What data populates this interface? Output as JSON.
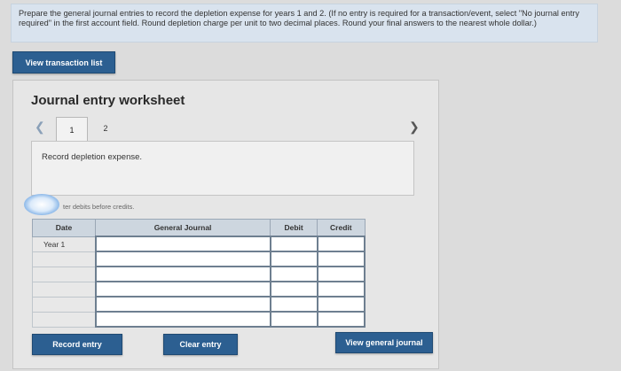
{
  "instructions": "Prepare the general journal entries to record the depletion expense for years 1 and 2. (If no entry is required for a transaction/event, select \"No journal entry required\" in the first account field. Round depletion charge per unit to two decimal places. Round your final answers to the nearest whole dollar.)",
  "buttons": {
    "view_transaction_list": "View transaction list",
    "record_entry": "Record entry",
    "clear_entry": "Clear entry",
    "view_general_journal": "View general journal"
  },
  "worksheet": {
    "title": "Journal entry worksheet",
    "prev_icon": "chevron-left",
    "next_icon": "chevron-right",
    "tabs": [
      "1",
      "2"
    ],
    "active_tab": "1",
    "prompt": "Record depletion expense.",
    "note": "ter debits before credits."
  },
  "table": {
    "headers": [
      "Date",
      "General Journal",
      "Debit",
      "Credit"
    ],
    "rows": [
      {
        "date": "Year 1",
        "account": "",
        "debit": "",
        "credit": ""
      },
      {
        "date": "",
        "account": "",
        "debit": "",
        "credit": ""
      },
      {
        "date": "",
        "account": "",
        "debit": "",
        "credit": ""
      },
      {
        "date": "",
        "account": "",
        "debit": "",
        "credit": ""
      },
      {
        "date": "",
        "account": "",
        "debit": "",
        "credit": ""
      },
      {
        "date": "",
        "account": "",
        "debit": "",
        "credit": ""
      }
    ]
  }
}
